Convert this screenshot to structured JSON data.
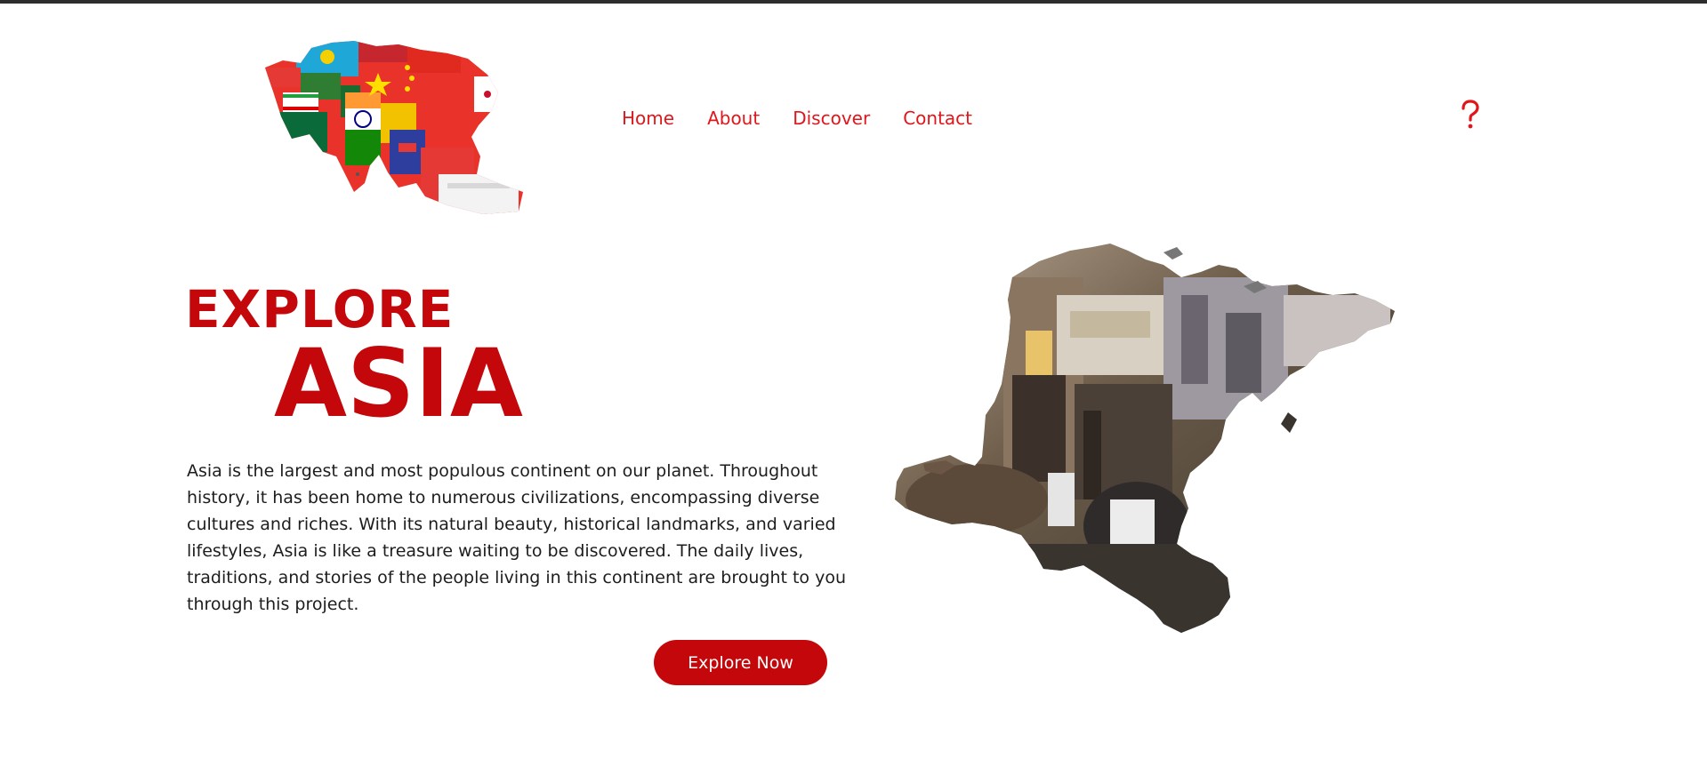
{
  "nav": {
    "items": [
      {
        "label": "Home"
      },
      {
        "label": "About"
      },
      {
        "label": "Discover"
      },
      {
        "label": "Contact"
      }
    ]
  },
  "header": {
    "logo_icon": "asia-flag-map-logo",
    "help_icon": "question-mark-icon"
  },
  "hero": {
    "title_line1": "EXPLORE",
    "title_line2": "ASIA",
    "description": "Asia is the largest and most populous continent on our planet. Throughout history, it has been home to numerous civilizations, encompassing diverse cultures and riches. With its natural beauty, historical landmarks, and varied lifestyles, Asia is like a treasure waiting to be discovered. The daily lives, traditions, and stories of the people living in this continent are brought to you through this project.",
    "button_label": "Explore Now",
    "image_icon": "asia-map-street-photo"
  },
  "colors": {
    "accent": "#c4070b",
    "nav": "#e0161b",
    "text": "#1d1d1d",
    "top_bar": "#2d2d2d"
  }
}
